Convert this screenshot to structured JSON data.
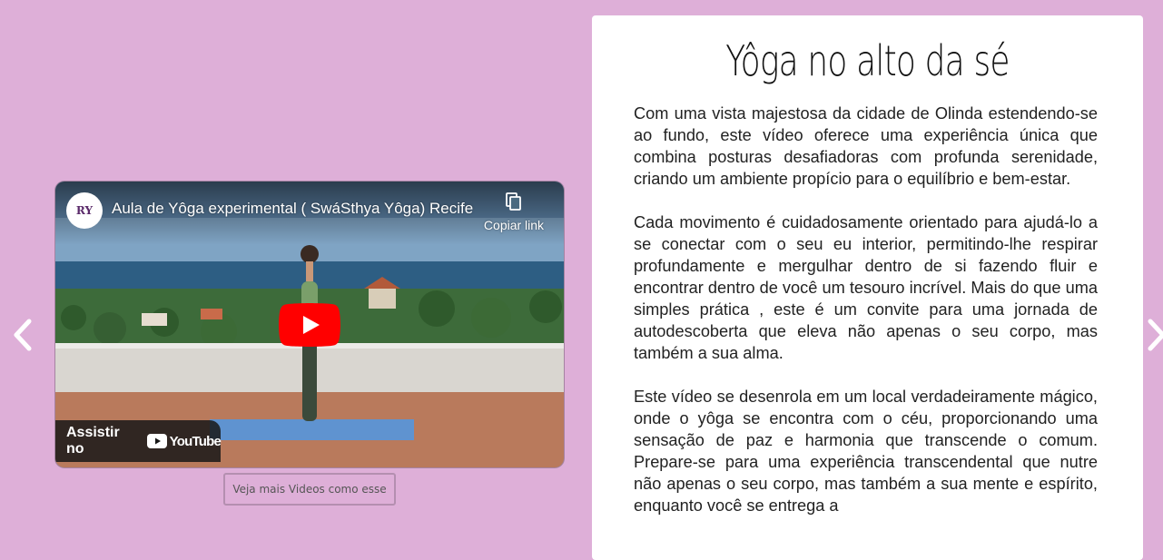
{
  "carousel": {
    "prev_icon": "chevron-left-icon",
    "next_icon": "chevron-right-icon"
  },
  "video": {
    "title": "Aula de Yôga experimental ( SwáSthya Yôga) Recife",
    "channel_avatar_text": "RY",
    "copy_link_label": "Copiar link",
    "watch_on_label": "Assistir no",
    "youtube_wordmark": "YouTube",
    "play_color": "#ff0000"
  },
  "more_videos_button": "Veja mais Videos como esse",
  "article": {
    "title": "Yôga no alto da sé",
    "paragraphs": [
      "Com uma vista majestosa da cidade de Olinda estendendo-se ao fundo, este vídeo oferece uma experiência única que combina posturas desafiadoras com profunda serenidade, criando um ambiente propício para o equilíbrio e bem-estar.",
      "Cada movimento é cuidadosamente orientado para ajudá-lo a se conectar com o seu eu interior, permitindo-lhe respirar profundamente e mergulhar dentro de si fazendo fluir e encontrar dentro de você um tesouro incrível. Mais do que uma simples prática , este é um convite para uma jornada de autodescoberta que eleva não apenas o seu corpo, mas também a sua alma.",
      "Este vídeo se desenrola em um local verdadeiramente mágico, onde o yôga se encontra com o céu, proporcionando uma sensação de paz e harmonia que transcende o comum. Prepare-se para uma experiência transcendental que nutre não apenas o seu corpo, mas também a sua mente e espírito, enquanto você se entrega a"
    ]
  },
  "colors": {
    "page_background": "#deafd8",
    "card_background": "#ffffff"
  }
}
